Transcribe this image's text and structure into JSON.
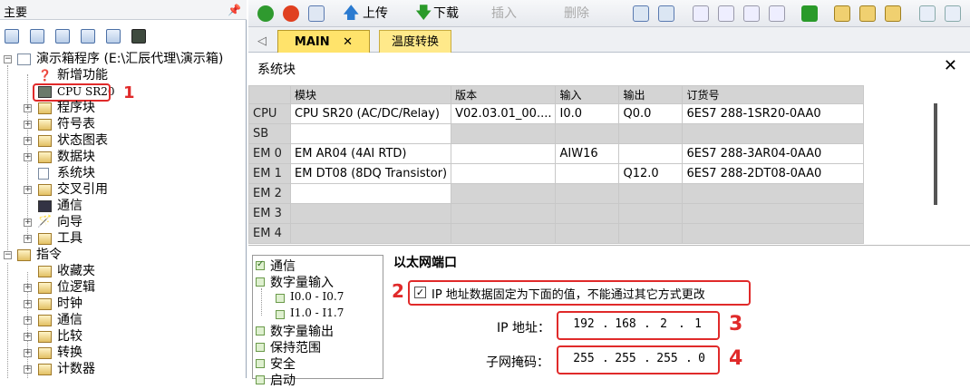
{
  "left": {
    "title": "主要",
    "tree": [
      {
        "label": "演示箱程序 (E:\\汇辰代理\\演示箱)"
      },
      {
        "label": "新增功能"
      },
      {
        "label": "CPU SR20"
      },
      {
        "label": "程序块"
      },
      {
        "label": "符号表"
      },
      {
        "label": "状态图表"
      },
      {
        "label": "数据块"
      },
      {
        "label": "系统块"
      },
      {
        "label": "交叉引用"
      },
      {
        "label": "通信"
      },
      {
        "label": "向导"
      },
      {
        "label": "工具"
      },
      {
        "label": "指令"
      },
      {
        "label": "收藏夹"
      },
      {
        "label": "位逻辑"
      },
      {
        "label": "时钟"
      },
      {
        "label": "通信"
      },
      {
        "label": "比较"
      },
      {
        "label": "转换"
      },
      {
        "label": "计数器"
      }
    ],
    "annotation": "1"
  },
  "toolbar": {
    "upload": "上传",
    "download": "下载",
    "insert": "插入",
    "delete": "删除"
  },
  "tabs": {
    "main": "MAIN",
    "temp": "温度转换"
  },
  "panel": {
    "title": "系统块",
    "close": "✕",
    "headers": [
      "",
      "模块",
      "版本",
      "输入",
      "输出",
      "订货号"
    ],
    "rows": [
      [
        "CPU",
        "CPU SR20 (AC/DC/Relay)",
        "V02.03.01_00....",
        "I0.0",
        "Q0.0",
        "6ES7 288-1SR20-0AA0"
      ],
      [
        "SB",
        "",
        "",
        "",
        "",
        ""
      ],
      [
        "EM 0",
        "EM AR04 (4AI RTD)",
        "",
        "AIW16",
        "",
        "6ES7 288-3AR04-0AA0"
      ],
      [
        "EM 1",
        "EM DT08 (8DQ Transistor)",
        "",
        "",
        "Q12.0",
        "6ES7 288-2DT08-0AA0"
      ],
      [
        "EM 2",
        "",
        "",
        "",
        "",
        ""
      ],
      [
        "EM 3",
        "",
        "",
        "",
        "",
        ""
      ],
      [
        "EM 4",
        "",
        "",
        "",
        "",
        ""
      ]
    ],
    "settings_tree": [
      {
        "label": "通信"
      },
      {
        "label": "数字量输入"
      },
      {
        "label": "I0.0 - I0.7"
      },
      {
        "label": "I1.0 - I1.7"
      },
      {
        "label": "数字量输出"
      },
      {
        "label": "保持范围"
      },
      {
        "label": "安全"
      },
      {
        "label": "启动"
      }
    ],
    "eth": {
      "heading": "以太网端口",
      "fixed_label": "IP 地址数据固定为下面的值，不能通过其它方式更改",
      "ip_label": "IP 地址：",
      "ip": [
        "192",
        "168",
        "2",
        "1"
      ],
      "mask_label": "子网掩码：",
      "mask": [
        "255",
        "255",
        "255",
        "0"
      ],
      "dot": "."
    },
    "annotations": [
      "2",
      "3",
      "4"
    ]
  }
}
